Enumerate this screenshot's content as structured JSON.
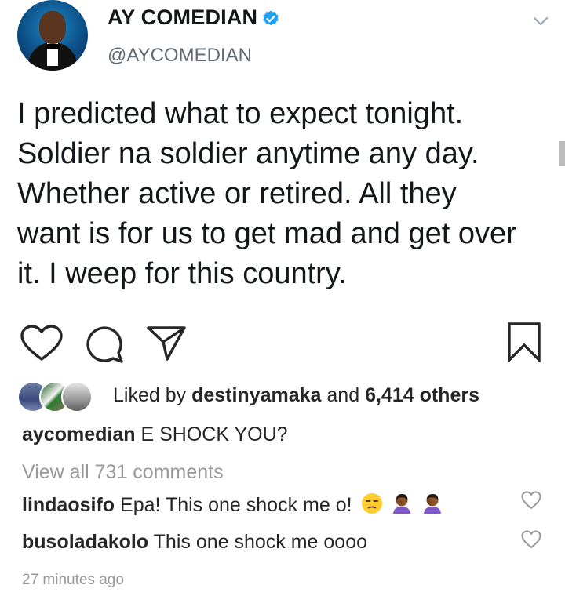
{
  "tweet": {
    "display_name": "AY COMEDIAN",
    "handle": "@AYCOMEDIAN",
    "text": "I predicted what to expect tonight.\nSoldier na soldier anytime any day.\nWhether active or retired. All they\nwant is for us to get mad and get over\nit. I weep for this country.",
    "colors": {
      "verified_badge": "#1da1f2",
      "name": "#14171a",
      "handle": "#5f6a73"
    },
    "icons": [
      "verified-badge-icon",
      "chevron-down-icon"
    ]
  },
  "post": {
    "icons": [
      "heart-icon",
      "comment-icon",
      "share-icon",
      "bookmark-icon"
    ],
    "likes": {
      "prefix": "Liked by",
      "user": "destinyamaka",
      "conjunction": "and",
      "others": "6,414 others"
    },
    "caption": {
      "user": "aycomedian",
      "text": "E SHOCK YOU?"
    },
    "view_all": "View all 731 comments",
    "comments": [
      {
        "user": "lindaosifo",
        "text": "Epa! This one shock me o!",
        "emoji_icons": [
          "unamused-face-emoji",
          "facepalm-emoji",
          "facepalm-emoji"
        ]
      },
      {
        "user": "busoladakolo",
        "text": "This one shock me oooo"
      }
    ],
    "timestamp": "27 minutes ago"
  }
}
